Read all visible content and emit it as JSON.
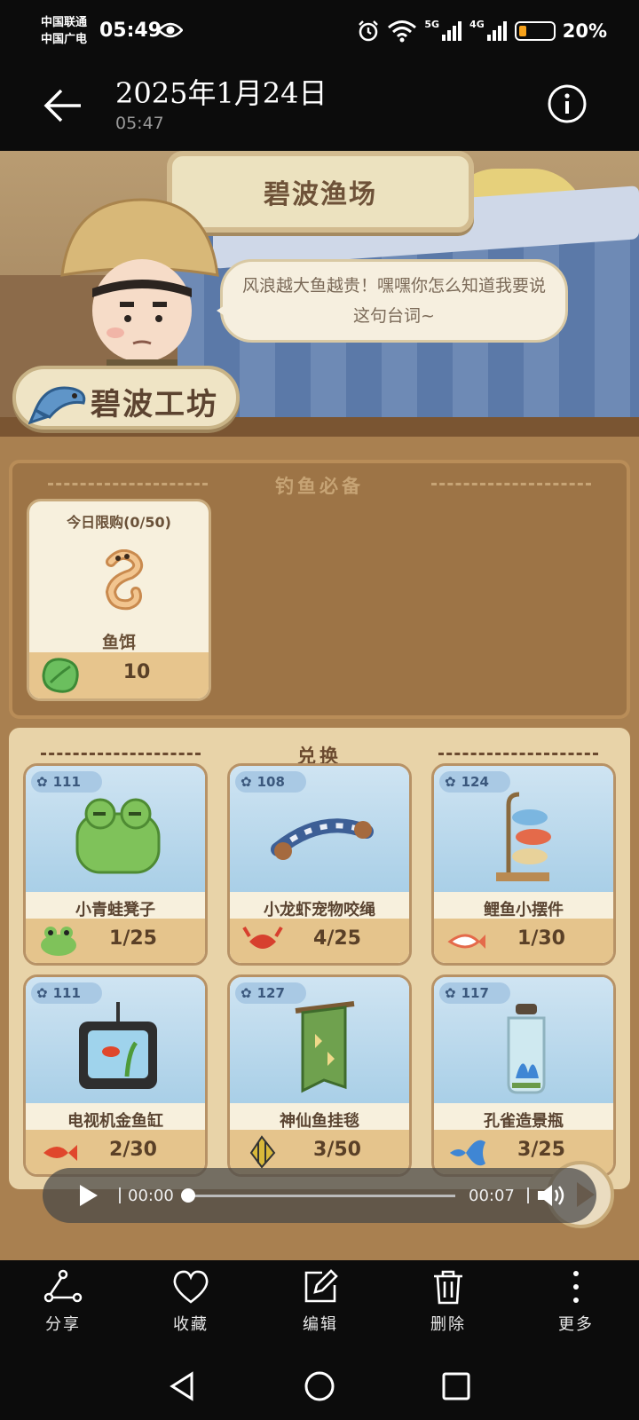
{
  "status_bar": {
    "carrier1": "中国联通",
    "carrier2": "中国广电",
    "time": "05:49",
    "signal1_label": "5G",
    "signal2_label": "4G",
    "battery_level": 0.2,
    "battery_text": "20%",
    "icons": [
      "eye-icon",
      "alarm-icon",
      "wifi-icon",
      "signal-icon",
      "battery-icon"
    ]
  },
  "header": {
    "date": "2025年1月24日",
    "time": "05:47"
  },
  "game": {
    "shop_title": "碧波渔场",
    "speech": "风浪越大鱼越贵！嘿嘿你怎么知道我要说这句台词~",
    "workshop": "碧波工坊",
    "section1": "钓鱼必备",
    "bait": {
      "limit": "今日限购(0/50)",
      "name": "鱼饵",
      "price": "10"
    },
    "section2": "兑换",
    "exchange": [
      {
        "badge": "111",
        "name": "小青蛙凳子",
        "progress": "1/25",
        "icon": "frog-icon",
        "color": "#7fc25a"
      },
      {
        "badge": "108",
        "name": "小龙虾宠物咬绳",
        "progress": "4/25",
        "icon": "crayfish-icon",
        "color": "#d7402e"
      },
      {
        "badge": "124",
        "name": "鲤鱼小摆件",
        "progress": "1/30",
        "icon": "koi-icon",
        "color": "#e46a4a"
      },
      {
        "badge": "111",
        "name": "电视机金鱼缸",
        "progress": "2/30",
        "icon": "goldfish-icon",
        "color": "#e0472c"
      },
      {
        "badge": "127",
        "name": "神仙鱼挂毯",
        "progress": "3/50",
        "icon": "angelfish-icon",
        "color": "#d9b93a"
      },
      {
        "badge": "117",
        "name": "孔雀造景瓶",
        "progress": "3/25",
        "icon": "guppy-icon",
        "color": "#3f86d4"
      }
    ]
  },
  "video": {
    "current": "00:00",
    "duration": "00:07",
    "progress": 0
  },
  "toolbar": {
    "share": "分享",
    "favorite": "收藏",
    "edit": "编辑",
    "delete": "删除",
    "more": "更多"
  }
}
